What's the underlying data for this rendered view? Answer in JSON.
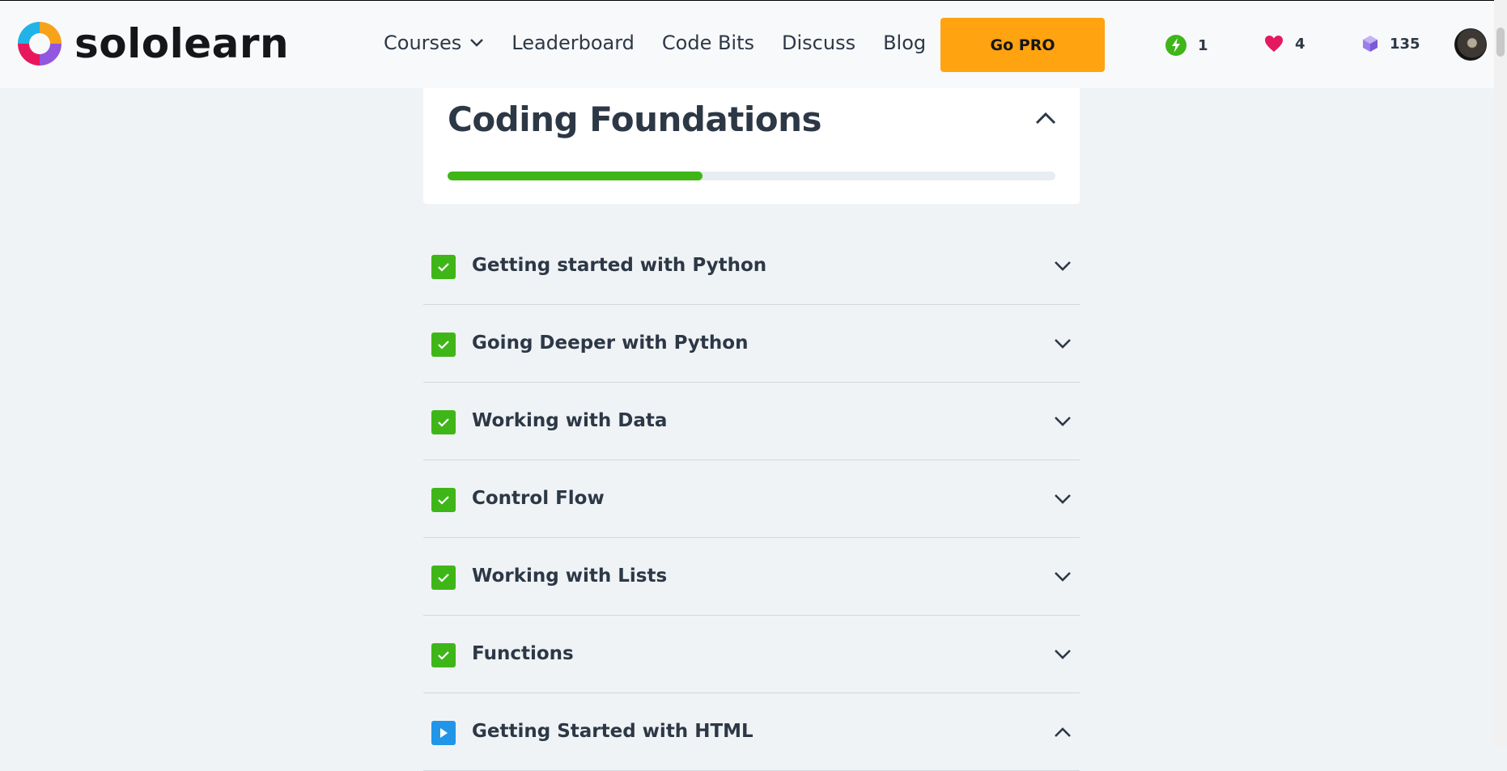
{
  "brand": {
    "name": "sololearn"
  },
  "nav": {
    "items": [
      {
        "label": "Courses",
        "has_dropdown": true
      },
      {
        "label": "Leaderboard"
      },
      {
        "label": "Code Bits"
      },
      {
        "label": "Discuss"
      },
      {
        "label": "Blog"
      }
    ],
    "cta": "Go PRO"
  },
  "stats": {
    "streak": "1",
    "hearts": "4",
    "bits": "135"
  },
  "course": {
    "title": "Coding Foundations",
    "progress_percent": 42,
    "expanded": true
  },
  "modules": [
    {
      "title": "Getting started with Python",
      "status": "completed",
      "expanded": false
    },
    {
      "title": "Going Deeper with Python",
      "status": "completed",
      "expanded": false
    },
    {
      "title": "Working with Data",
      "status": "completed",
      "expanded": false
    },
    {
      "title": "Control Flow",
      "status": "completed",
      "expanded": false
    },
    {
      "title": "Working with Lists",
      "status": "completed",
      "expanded": false
    },
    {
      "title": "Functions",
      "status": "completed",
      "expanded": false
    },
    {
      "title": "Getting Started with HTML",
      "status": "in-progress",
      "expanded": true
    }
  ],
  "colors": {
    "accent": "#ffa310",
    "success": "#3fb618",
    "active": "#2196e8",
    "heart": "#e5195f",
    "bits": "#9c7ee8"
  }
}
